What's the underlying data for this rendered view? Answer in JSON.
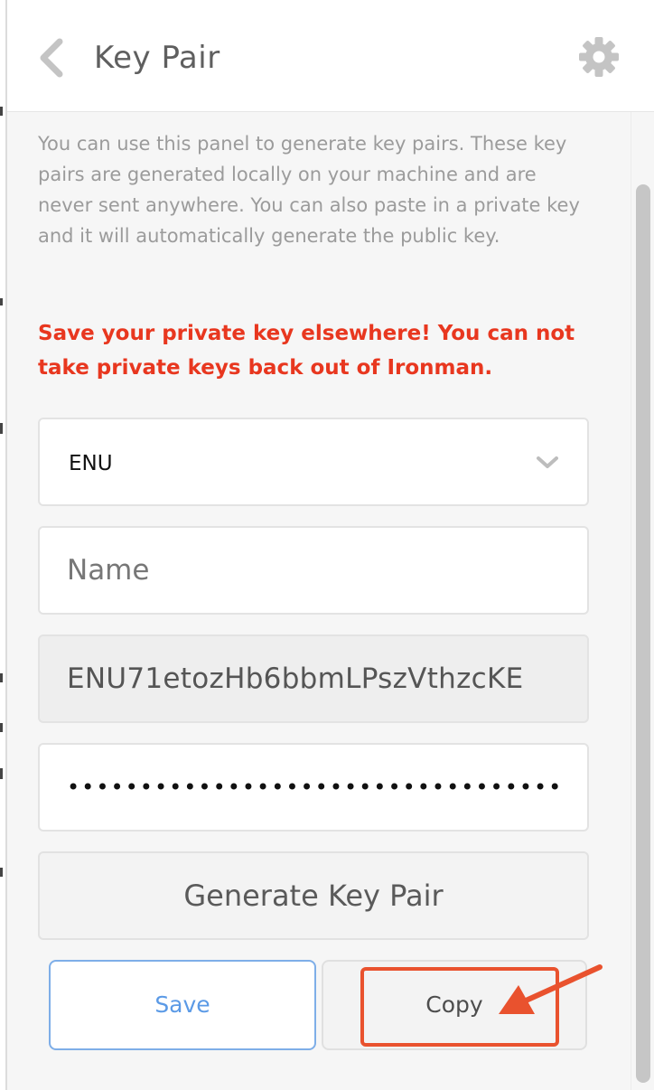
{
  "header": {
    "title": "Key Pair"
  },
  "panel": {
    "description": "You can use this panel to generate key pairs. These key pairs are generated locally on your machine and are never sent anywhere. You can also paste in a private key and it will automatically generate the public key.",
    "warning": "Save your private key elsewhere! You can not take private keys back out of Ironman."
  },
  "form": {
    "blockchain_select": {
      "selected": "ENU"
    },
    "name_field": {
      "placeholder": "Name",
      "value": ""
    },
    "public_key_field": {
      "value": "ENU71etozHb6bbmLPszVthzcKE"
    },
    "private_key_field": {
      "value": "••••••••••••••••••••••••••••••••••••••••"
    },
    "generate_button": "Generate Key Pair",
    "save_button": "Save",
    "copy_button": "Copy"
  },
  "annotation": {
    "highlight_color": "#e9522e"
  },
  "colors": {
    "warning": "#e8371f",
    "save_accent": "#5b9ae6",
    "background": "#f6f6f6"
  }
}
